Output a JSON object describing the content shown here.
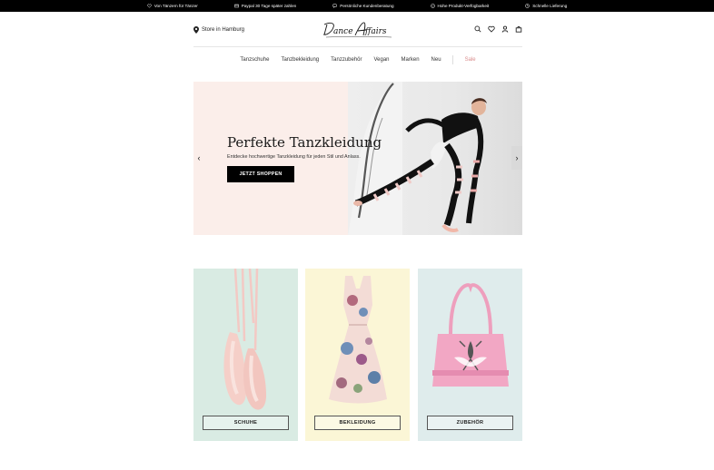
{
  "topbar": {
    "items": [
      {
        "icon": "heart-icon",
        "label": "Von Tänzern für Tänzer"
      },
      {
        "icon": "card-icon",
        "label": "Paypal 30 Tage später zahlen"
      },
      {
        "icon": "chat-icon",
        "label": "Persönliche Kundenberatung"
      },
      {
        "icon": "check-icon",
        "label": "Hohe Produkt-Verfügbarkeit"
      },
      {
        "icon": "truck-icon",
        "label": "Schnelle Lieferung"
      }
    ]
  },
  "header": {
    "store_label": "Store in Hamburg",
    "logo_text": "Dance Affairs",
    "icons": [
      "search-icon",
      "heart-icon",
      "user-icon",
      "bag-icon"
    ]
  },
  "nav": {
    "items": [
      "Tanzschuhe",
      "Tanzbekleidung",
      "Tanzzubehör",
      "Vegan",
      "Marken",
      "Neu"
    ],
    "sale": "Sale",
    "sale_color": "#d98c8c"
  },
  "hero": {
    "title": "Perfekte Tanzkleidung",
    "subtitle": "Entdecke hochwertige Tanzkleidung für jeden Stil und Anlass.",
    "cta": "JETZT SHOPPEN",
    "prev_arrow": "‹",
    "next_arrow": "›",
    "bg_color": "#fbeeea"
  },
  "categories": [
    {
      "label": "SCHUHE",
      "bg": "#d9ebe3"
    },
    {
      "label": "BEKLEIDUNG",
      "bg": "#fbf6d6"
    },
    {
      "label": "ZUBEHÖR",
      "bg": "#dfecec"
    }
  ]
}
